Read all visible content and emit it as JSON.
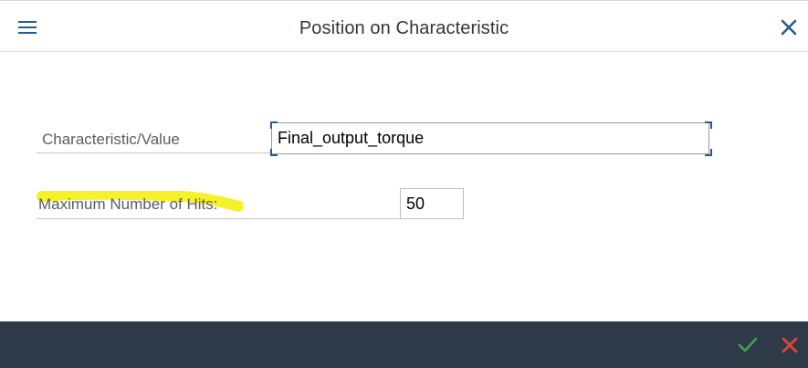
{
  "dialog": {
    "title": "Position on Characteristic"
  },
  "form": {
    "characteristic": {
      "label": "Characteristic/Value",
      "value": "Final_output_torque"
    },
    "max_hits": {
      "label": "Maximum Number of Hits:",
      "value": "50"
    }
  },
  "colors": {
    "accent": "#2a5b8a",
    "footer_bg": "#2f3a48",
    "highlight": "#f5f020",
    "ok_green": "#3fa34d",
    "cancel_red": "#e0443c"
  },
  "icons": {
    "menu": "menu-icon",
    "close": "close-icon",
    "ok": "checkmark-icon",
    "cancel": "cancel-x-icon"
  }
}
